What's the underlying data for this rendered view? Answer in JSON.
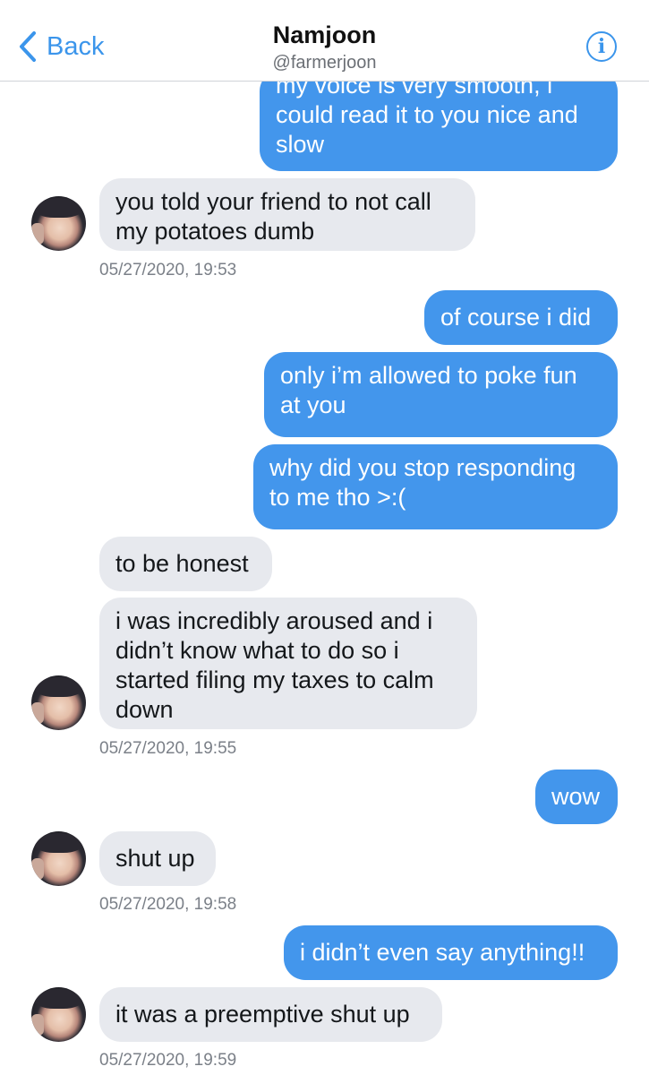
{
  "header": {
    "back_label": "Back",
    "name": "Namjoon",
    "handle": "@farmerjoon",
    "info_icon": "info-icon"
  },
  "messages": [
    {
      "from": "me",
      "text": "my voice is very smooth, i could read it to you nice and slow"
    },
    {
      "from": "them",
      "text": "you told your friend to not call my potatoes dumb"
    },
    {
      "timestamp": "05/27/2020, 19:53"
    },
    {
      "from": "me",
      "text": "of course i did"
    },
    {
      "from": "me",
      "text": "only i’m allowed to poke fun at you"
    },
    {
      "from": "me",
      "text": "why did you stop responding to me tho >:("
    },
    {
      "from": "them",
      "text": "to be honest"
    },
    {
      "from": "them",
      "text": "i was incredibly aroused and i didn’t know what to do so i started filing my taxes to calm down"
    },
    {
      "timestamp": "05/27/2020, 19:55"
    },
    {
      "from": "me",
      "text": "wow"
    },
    {
      "from": "them",
      "text": "shut up"
    },
    {
      "timestamp": "05/27/2020, 19:58"
    },
    {
      "from": "me",
      "text": "i didn’t even say anything!!"
    },
    {
      "from": "them",
      "text": "it was a preemptive shut up"
    },
    {
      "timestamp": "05/27/2020, 19:59"
    }
  ],
  "colors": {
    "accent": "#3b95eb",
    "outgoing_bubble": "#4396ec",
    "incoming_bubble": "#e7e9ee"
  }
}
